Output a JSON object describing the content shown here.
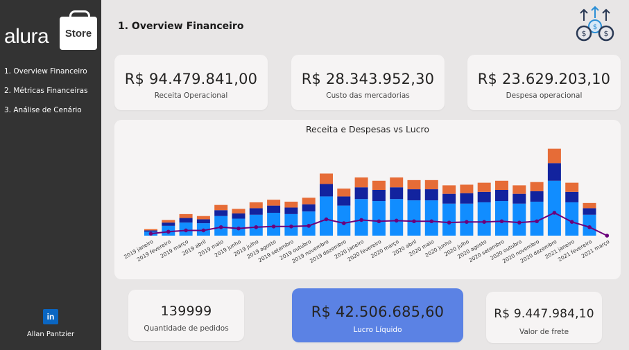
{
  "sidebar": {
    "logo_text": "alura",
    "logo_badge": "Store",
    "items": [
      {
        "label": "1. Overview Financeiro"
      },
      {
        "label": "2. Métricas Financeiras"
      },
      {
        "label": "3. Análise de Cenário"
      }
    ],
    "author_icon": "linkedin-icon",
    "author_icon_text": "in",
    "author_name": "Allan Pantzier"
  },
  "header": {
    "title": "1. Overview Financeiro",
    "icon": "money-growth-icon"
  },
  "kpis": {
    "receita": {
      "value": "R$ 94.479.841,00",
      "label": "Receita Operacional"
    },
    "custo": {
      "value": "R$ 28.343.952,30",
      "label": "Custo das mercadorias"
    },
    "despesa": {
      "value": "R$ 23.629.203,10",
      "label": "Despesa operacional"
    },
    "pedidos": {
      "value": "139999",
      "label": "Quantidade de pedidos"
    },
    "lucro": {
      "value": "R$ 42.506.685,60",
      "label": "Lucro Líquido"
    },
    "frete": {
      "value": "R$ 9.447.984,10",
      "label": "Valor de frete"
    }
  },
  "colors": {
    "sidebar": "#333333",
    "receita_bar": "#118dff",
    "custo_bar": "#12239e",
    "despesa_bar": "#e66c37",
    "lucro_line": "#6b007b",
    "highlight_card": "#5b82e4"
  },
  "chart_data": {
    "type": "bar",
    "title": "Receita e Despesas vs Lucro",
    "stacked": true,
    "categories": [
      "2019 janeiro",
      "2019 fevereiro",
      "2019 março",
      "2019 abril",
      "2019 maio",
      "2019 junho",
      "2019 julho",
      "2019 agosto",
      "2019 setembro",
      "2019 outubro",
      "2019 novembro",
      "2019 dezembro",
      "2020 janeiro",
      "2020 fevereiro",
      "2020 março",
      "2020 abril",
      "2020 maio",
      "2020 junho",
      "2020 julho",
      "2020 agosto",
      "2020 setembro",
      "2020 outubro",
      "2020 novembro",
      "2020 dezembro",
      "2021 janeiro",
      "2021 fevereiro",
      "2021 março"
    ],
    "series": [
      {
        "kind": "bar",
        "values": [
          0.6,
          1.5,
          2.0,
          1.9,
          3.0,
          2.6,
          3.2,
          3.5,
          3.3,
          3.7,
          6.0,
          4.6,
          5.6,
          5.3,
          5.6,
          5.4,
          5.4,
          4.9,
          4.9,
          5.1,
          5.3,
          4.9,
          5.2,
          8.4,
          5.1,
          3.2,
          0.0
        ]
      },
      {
        "kind": "bar",
        "values": [
          0.2,
          0.5,
          0.7,
          0.6,
          0.9,
          0.8,
          1.0,
          1.1,
          1.0,
          1.1,
          1.9,
          1.4,
          1.8,
          1.7,
          1.8,
          1.7,
          1.7,
          1.5,
          1.6,
          1.6,
          1.7,
          1.5,
          1.6,
          2.7,
          1.6,
          1.0,
          0.0
        ]
      },
      {
        "kind": "bar",
        "values": [
          0.2,
          0.4,
          0.6,
          0.5,
          0.8,
          0.7,
          0.9,
          0.9,
          0.9,
          1.0,
          1.6,
          1.2,
          1.5,
          1.4,
          1.5,
          1.4,
          1.4,
          1.3,
          1.3,
          1.4,
          1.4,
          1.3,
          1.4,
          2.2,
          1.4,
          0.8,
          0.0
        ]
      },
      {
        "kind": "line",
        "values": [
          0.3,
          0.6,
          0.8,
          0.8,
          1.3,
          1.1,
          1.3,
          1.4,
          1.4,
          1.5,
          2.5,
          1.9,
          2.4,
          2.2,
          2.3,
          2.2,
          2.2,
          2.0,
          2.1,
          2.1,
          2.2,
          2.0,
          2.2,
          3.5,
          2.1,
          1.3,
          0.0
        ]
      }
    ],
    "legend": "none",
    "grid": false,
    "ylim": [
      0,
      14
    ]
  }
}
